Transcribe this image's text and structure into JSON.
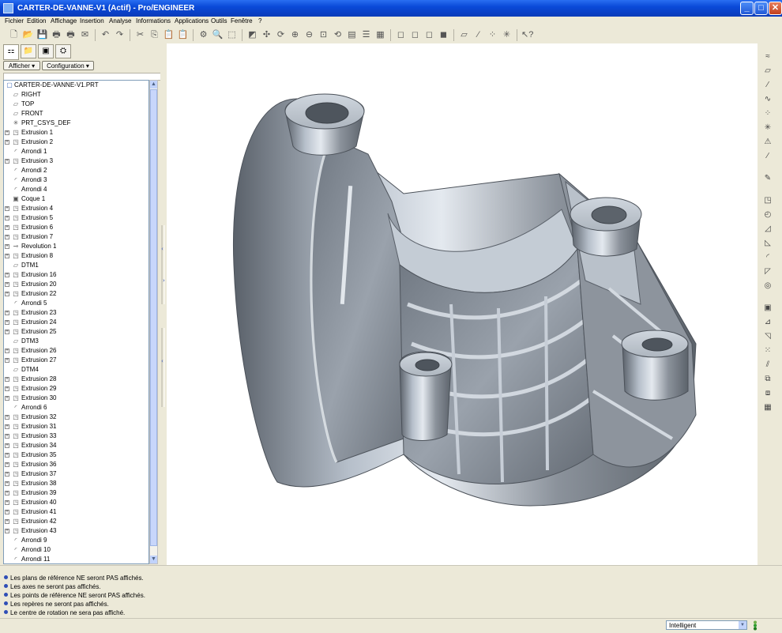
{
  "window": {
    "title": "CARTER-DE-VANNE-V1 (Actif) - Pro/ENGINEER",
    "minimize_glyph": "_",
    "maximize_glyph": "□",
    "close_glyph": "✕"
  },
  "menu": [
    "Fichier",
    "Edition",
    "Affichage",
    "Insertion",
    "Analyse",
    "Informations",
    "Applications",
    "Outils",
    "Fenêtre",
    "?"
  ],
  "nav": {
    "show_label": "Afficher ▾",
    "config_label": "Configuration ▾"
  },
  "tree": {
    "root": "CARTER-DE-VANNE-V1.PRT",
    "items": [
      {
        "label": "RIGHT",
        "icon": "datum-plane-icon",
        "glyph": "▱",
        "expandable": false
      },
      {
        "label": "TOP",
        "icon": "datum-plane-icon",
        "glyph": "▱",
        "expandable": false
      },
      {
        "label": "FRONT",
        "icon": "datum-plane-icon",
        "glyph": "▱",
        "expandable": false
      },
      {
        "label": "PRT_CSYS_DEF",
        "icon": "csys-icon",
        "glyph": "✳",
        "expandable": false
      },
      {
        "label": "Extrusion 1",
        "icon": "extrude-icon",
        "glyph": "◳",
        "expandable": true
      },
      {
        "label": "Extrusion 2",
        "icon": "extrude-icon",
        "glyph": "◳",
        "expandable": true
      },
      {
        "label": "Arrondi 1",
        "icon": "round-icon",
        "glyph": "◜",
        "expandable": false
      },
      {
        "label": "Extrusion 3",
        "icon": "extrude-icon",
        "glyph": "◳",
        "expandable": true
      },
      {
        "label": "Arrondi 2",
        "icon": "round-icon",
        "glyph": "◜",
        "expandable": false
      },
      {
        "label": "Arrondi 3",
        "icon": "round-icon",
        "glyph": "◜",
        "expandable": false
      },
      {
        "label": "Arrondi 4",
        "icon": "round-icon",
        "glyph": "◜",
        "expandable": false
      },
      {
        "label": "Coque 1",
        "icon": "shell-icon",
        "glyph": "▣",
        "expandable": false
      },
      {
        "label": "Extrusion 4",
        "icon": "extrude-icon",
        "glyph": "◳",
        "expandable": true
      },
      {
        "label": "Extrusion 5",
        "icon": "extrude-icon",
        "glyph": "◳",
        "expandable": true
      },
      {
        "label": "Extrusion 6",
        "icon": "extrude-icon",
        "glyph": "◳",
        "expandable": true
      },
      {
        "label": "Extrusion 7",
        "icon": "extrude-icon",
        "glyph": "◳",
        "expandable": true
      },
      {
        "label": "Revolution 1",
        "icon": "revolve-icon",
        "glyph": "⊸",
        "expandable": true
      },
      {
        "label": "Extrusion 8",
        "icon": "extrude-icon",
        "glyph": "◳",
        "expandable": true
      },
      {
        "label": "DTM1",
        "icon": "datum-plane-icon",
        "glyph": "▱",
        "expandable": false
      },
      {
        "label": "Extrusion 16",
        "icon": "extrude-icon",
        "glyph": "◳",
        "expandable": true
      },
      {
        "label": "Extrusion 20",
        "icon": "extrude-icon",
        "glyph": "◳",
        "expandable": true
      },
      {
        "label": "Extrusion 22",
        "icon": "extrude-icon",
        "glyph": "◳",
        "expandable": true
      },
      {
        "label": "Arrondi 5",
        "icon": "round-icon",
        "glyph": "◜",
        "expandable": false
      },
      {
        "label": "Extrusion 23",
        "icon": "extrude-icon",
        "glyph": "◳",
        "expandable": true
      },
      {
        "label": "Extrusion 24",
        "icon": "extrude-icon",
        "glyph": "◳",
        "expandable": true
      },
      {
        "label": "Extrusion 25",
        "icon": "extrude-icon",
        "glyph": "◳",
        "expandable": true
      },
      {
        "label": "DTM3",
        "icon": "datum-plane-icon",
        "glyph": "▱",
        "expandable": false
      },
      {
        "label": "Extrusion 26",
        "icon": "extrude-icon",
        "glyph": "◳",
        "expandable": true
      },
      {
        "label": "Extrusion 27",
        "icon": "extrude-icon",
        "glyph": "◳",
        "expandable": true
      },
      {
        "label": "DTM4",
        "icon": "datum-plane-icon",
        "glyph": "▱",
        "expandable": false
      },
      {
        "label": "Extrusion 28",
        "icon": "extrude-icon",
        "glyph": "◳",
        "expandable": true
      },
      {
        "label": "Extrusion 29",
        "icon": "extrude-icon",
        "glyph": "◳",
        "expandable": true
      },
      {
        "label": "Extrusion 30",
        "icon": "extrude-icon",
        "glyph": "◳",
        "expandable": true
      },
      {
        "label": "Arrondi 6",
        "icon": "round-icon",
        "glyph": "◜",
        "expandable": false
      },
      {
        "label": "Extrusion 32",
        "icon": "extrude-icon",
        "glyph": "◳",
        "expandable": true
      },
      {
        "label": "Extrusion 31",
        "icon": "extrude-icon",
        "glyph": "◳",
        "expandable": true
      },
      {
        "label": "Extrusion 33",
        "icon": "extrude-icon",
        "glyph": "◳",
        "expandable": true
      },
      {
        "label": "Extrusion 34",
        "icon": "extrude-icon",
        "glyph": "◳",
        "expandable": true
      },
      {
        "label": "Extrusion 35",
        "icon": "extrude-icon",
        "glyph": "◳",
        "expandable": true
      },
      {
        "label": "Extrusion 36",
        "icon": "extrude-icon",
        "glyph": "◳",
        "expandable": true
      },
      {
        "label": "Extrusion 37",
        "icon": "extrude-icon",
        "glyph": "◳",
        "expandable": true
      },
      {
        "label": "Extrusion 38",
        "icon": "extrude-icon",
        "glyph": "◳",
        "expandable": true
      },
      {
        "label": "Extrusion 39",
        "icon": "extrude-icon",
        "glyph": "◳",
        "expandable": true
      },
      {
        "label": "Extrusion 40",
        "icon": "extrude-icon",
        "glyph": "◳",
        "expandable": true
      },
      {
        "label": "Extrusion 41",
        "icon": "extrude-icon",
        "glyph": "◳",
        "expandable": true
      },
      {
        "label": "Extrusion 42",
        "icon": "extrude-icon",
        "glyph": "◳",
        "expandable": true
      },
      {
        "label": "Extrusion 43",
        "icon": "extrude-icon",
        "glyph": "◳",
        "expandable": true
      },
      {
        "label": "Arrondi 9",
        "icon": "round-icon",
        "glyph": "◜",
        "expandable": false
      },
      {
        "label": "Arrondi 10",
        "icon": "round-icon",
        "glyph": "◜",
        "expandable": false
      },
      {
        "label": "Arrondi 11",
        "icon": "round-icon",
        "glyph": "◜",
        "expandable": false
      }
    ]
  },
  "messages": [
    "Les plans de référence NE seront PAS affichés.",
    "Les axes ne seront pas affichés.",
    "Les points de référence NE seront PAS affichés.",
    "Les repères ne seront pas affichés.",
    "Le centre de rotation ne sera pas affiché."
  ],
  "status": {
    "selection_filter": "Intelligent"
  },
  "toolbar_icons": [
    {
      "name": "new-file-icon",
      "glyph": "🗋"
    },
    {
      "name": "open-file-icon",
      "glyph": "📂"
    },
    {
      "name": "save-icon",
      "glyph": "💾"
    },
    {
      "name": "print-icon",
      "glyph": "🖶"
    },
    {
      "name": "print-preview-icon",
      "glyph": "🖶"
    },
    {
      "name": "email-icon",
      "glyph": "✉"
    },
    {
      "name": "undo-icon",
      "glyph": "↶"
    },
    {
      "name": "redo-icon",
      "glyph": "↷"
    },
    {
      "name": "cut-icon",
      "glyph": "✂"
    },
    {
      "name": "copy-icon",
      "glyph": "⎘"
    },
    {
      "name": "paste-icon",
      "glyph": "📋"
    },
    {
      "name": "paste-special-icon",
      "glyph": "📋"
    },
    {
      "name": "regenerate-icon",
      "glyph": "⚙"
    },
    {
      "name": "find-icon",
      "glyph": "🔍"
    },
    {
      "name": "select-box-icon",
      "glyph": "⬚"
    },
    {
      "name": "repaint-icon",
      "glyph": "◩"
    },
    {
      "name": "spin-center-icon",
      "glyph": "✣"
    },
    {
      "name": "orient-mode-icon",
      "glyph": "⟳"
    },
    {
      "name": "zoom-in-icon",
      "glyph": "⊕"
    },
    {
      "name": "zoom-out-icon",
      "glyph": "⊖"
    },
    {
      "name": "refit-icon",
      "glyph": "⊡"
    },
    {
      "name": "reorient-icon",
      "glyph": "⟲"
    },
    {
      "name": "saved-views-icon",
      "glyph": "▤"
    },
    {
      "name": "layers-icon",
      "glyph": "☰"
    },
    {
      "name": "view-manager-icon",
      "glyph": "▦"
    },
    {
      "name": "wireframe-icon",
      "glyph": "◻"
    },
    {
      "name": "hidden-line-icon",
      "glyph": "◻"
    },
    {
      "name": "no-hidden-icon",
      "glyph": "◻"
    },
    {
      "name": "shading-icon",
      "glyph": "◼"
    },
    {
      "name": "datum-plane-display-icon",
      "glyph": "▱"
    },
    {
      "name": "datum-axis-display-icon",
      "glyph": "⁄"
    },
    {
      "name": "datum-point-display-icon",
      "glyph": "⁘"
    },
    {
      "name": "csys-display-icon",
      "glyph": "✳"
    },
    {
      "name": "context-help-icon",
      "glyph": "↖?"
    }
  ],
  "right_toolbar_icons": [
    {
      "name": "sketch-tool-icon",
      "glyph": "≈"
    },
    {
      "name": "datum-plane-tool-icon",
      "glyph": "▱"
    },
    {
      "name": "datum-axis-tool-icon",
      "glyph": "⁄"
    },
    {
      "name": "datum-curve-tool-icon",
      "glyph": "∿"
    },
    {
      "name": "datum-point-tool-icon",
      "glyph": "⁘"
    },
    {
      "name": "csys-tool-icon",
      "glyph": "✳"
    },
    {
      "name": "analysis-tool-icon",
      "glyph": "⚠"
    },
    {
      "name": "disabled-tool-icon",
      "glyph": "∕"
    },
    {
      "name": "annotation-tool-icon",
      "glyph": "✎"
    },
    {
      "name": "extrude-tool-icon",
      "glyph": "◳"
    },
    {
      "name": "revolve-tool-icon",
      "glyph": "◴"
    },
    {
      "name": "sweep-tool-icon",
      "glyph": "◿"
    },
    {
      "name": "blend-tool-icon",
      "glyph": "◺"
    },
    {
      "name": "round-tool-icon",
      "glyph": "◜"
    },
    {
      "name": "chamfer-tool-icon",
      "glyph": "◸"
    },
    {
      "name": "hole-tool-icon",
      "glyph": "◎"
    },
    {
      "name": "shell-tool-icon",
      "glyph": "▣"
    },
    {
      "name": "rib-tool-icon",
      "glyph": "⊿"
    },
    {
      "name": "draft-tool-icon",
      "glyph": "◹"
    },
    {
      "name": "pattern-tool-icon",
      "glyph": "⁙"
    },
    {
      "name": "mirror-tool-icon",
      "glyph": "⫽"
    },
    {
      "name": "merge-tool-icon",
      "glyph": "⧉"
    },
    {
      "name": "trim-tool-icon",
      "glyph": "⧈"
    },
    {
      "name": "offset-tool-icon",
      "glyph": "▦"
    }
  ]
}
